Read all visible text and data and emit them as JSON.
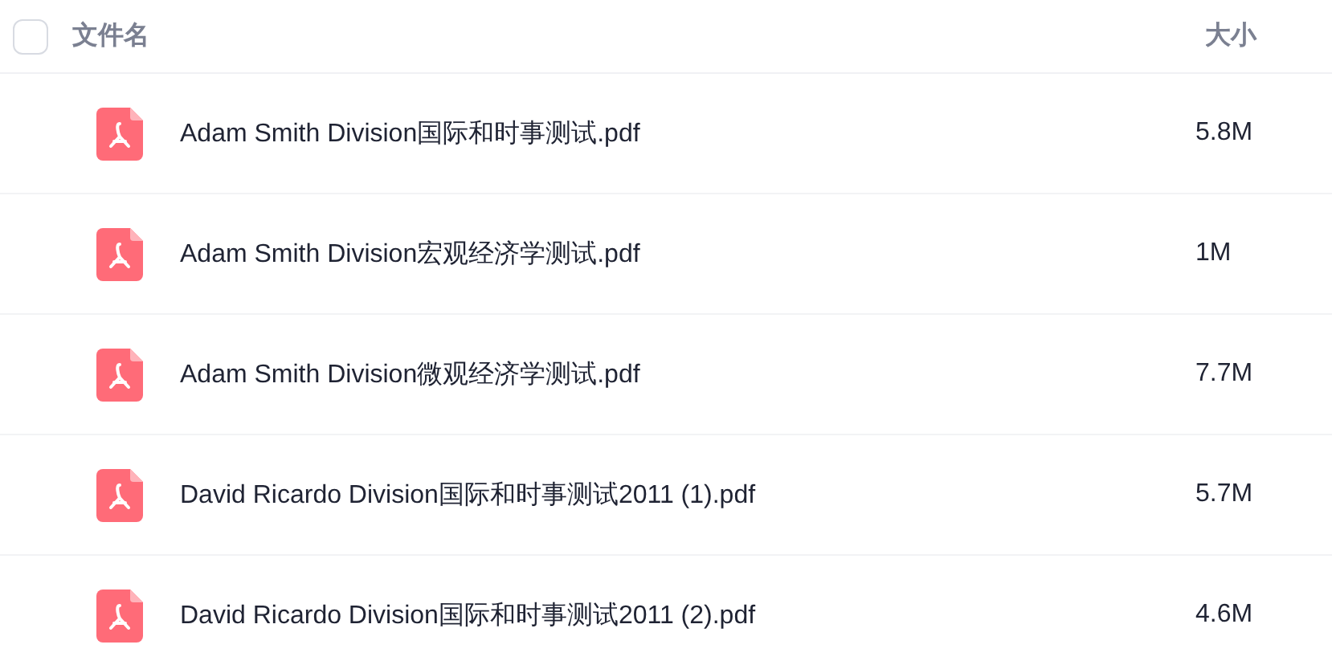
{
  "header": {
    "checked": false,
    "name_label": "文件名",
    "size_label": "大小"
  },
  "files": [
    {
      "name": "Adam Smith Division国际和时事测试.pdf",
      "size": "5.8M"
    },
    {
      "name": "Adam Smith Division宏观经济学测试.pdf",
      "size": "1M"
    },
    {
      "name": "Adam Smith Division微观经济学测试.pdf",
      "size": "7.7M"
    },
    {
      "name": "David Ricardo Division国际和时事测试2011 (1).pdf",
      "size": "5.7M"
    },
    {
      "name": "David Ricardo Division国际和时事测试2011 (2).pdf",
      "size": "4.6M"
    }
  ]
}
